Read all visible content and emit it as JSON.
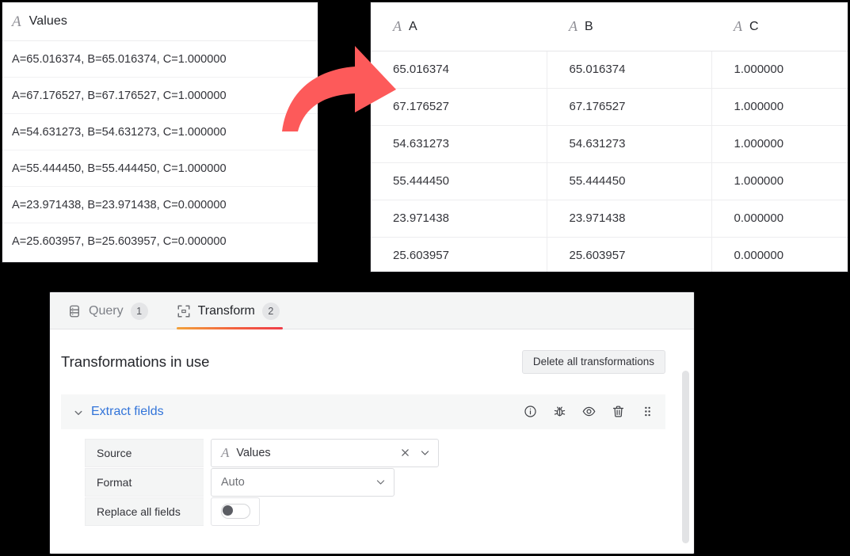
{
  "raw_panel": {
    "column_icon": "string-type-icon",
    "column_name": "Values",
    "rows": [
      "A=65.016374, B=65.016374, C=1.000000",
      "A=67.176527, B=67.176527, C=1.000000",
      "A=54.631273, B=54.631273, C=1.000000",
      "A=55.444450, B=55.444450, C=1.000000",
      "A=23.971438, B=23.971438, C=0.000000",
      "A=25.603957, B=25.603957, C=0.000000"
    ]
  },
  "result_table": {
    "headers": [
      "A",
      "B",
      "C"
    ],
    "rows": [
      [
        "65.016374",
        "65.016374",
        "1.000000"
      ],
      [
        "67.176527",
        "67.176527",
        "1.000000"
      ],
      [
        "54.631273",
        "54.631273",
        "1.000000"
      ],
      [
        "55.444450",
        "55.444450",
        "1.000000"
      ],
      [
        "23.971438",
        "23.971438",
        "0.000000"
      ],
      [
        "25.603957",
        "25.603957",
        "0.000000"
      ]
    ]
  },
  "arrow": {
    "name": "red-curved-arrow",
    "color": "#FD5A5A",
    "direction": "right"
  },
  "transform_panel": {
    "tabs": [
      {
        "label": "Query",
        "count": "1",
        "active": false,
        "icon": "database-icon"
      },
      {
        "label": "Transform",
        "count": "2",
        "active": true,
        "icon": "transform-icon"
      }
    ],
    "active_tab_accent_from": "#F2A23C",
    "active_tab_accent_to": "#EF3E4A",
    "section_title": "Transformations in use",
    "delete_all_label": "Delete all transformations",
    "transformation": {
      "title": "Extract fields",
      "title_color": "#3274D9",
      "expanded": true,
      "actions": [
        "info-icon",
        "debug-bug-icon",
        "eye-icon",
        "trash-icon",
        "drag-handle-icon"
      ],
      "fields": [
        {
          "label": "Source",
          "type": "select",
          "value": "Values",
          "value_icon": "string-type-icon",
          "clearable": true
        },
        {
          "label": "Format",
          "type": "select",
          "value": "Auto",
          "clearable": false
        },
        {
          "label": "Replace all fields",
          "type": "toggle",
          "value": "off"
        }
      ]
    }
  }
}
